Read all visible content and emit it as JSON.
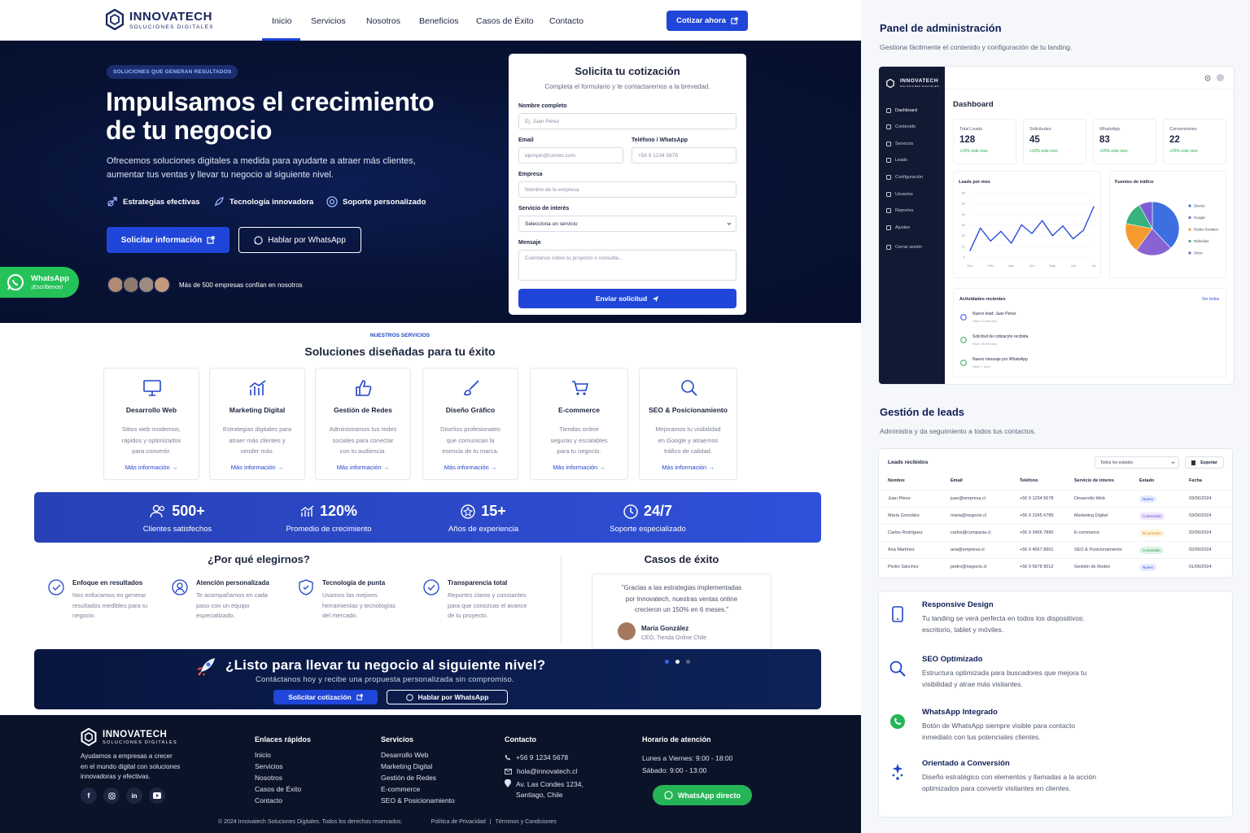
{
  "brand": {
    "name": "INNOVATECH",
    "tagline": "SOLUCIONES DIGITALES"
  },
  "nav": {
    "items": [
      "Inicio",
      "Servicios",
      "Nosotros",
      "Beneficios",
      "Casos de Éxito",
      "Contacto"
    ],
    "cta": "Cotizar ahora"
  },
  "hero": {
    "pill": "SOLUCIONES QUE GENERAN RESULTADOS",
    "title_1": "Impulsamos el crecimiento",
    "title_2": "de tu negocio",
    "subtitle_1": "Ofrecemos soluciones digitales a medida para ayudarte a atraer más clientes,",
    "subtitle_2": "aumentar tus ventas y llevar tu negocio al siguiente nivel.",
    "features": [
      "Estrategias efectivas",
      "Tecnología innovadora",
      "Soporte personalizado"
    ],
    "btn_primary": "Solicitar información",
    "btn_secondary": "Hablar por WhatsApp",
    "trust": "Más de 500 empresas confían en nosotros"
  },
  "whatsapp_float": {
    "title": "WhatsApp",
    "sub": "¡Escríbenos!"
  },
  "form": {
    "title": "Solicita tu cotización",
    "subtitle": "Completa el formulario y te contactaremos a la brevedad.",
    "name_label": "Nombre completo",
    "name_ph": "Ej. Juan Pérez",
    "email_label": "Email",
    "email_ph": "ejemplo@correo.com",
    "phone_label": "Teléfono / WhatsApp",
    "phone_ph": "+56 9 1234 5678",
    "company_label": "Empresa",
    "company_ph": "Nombre de tu empresa",
    "service_label": "Servicio de interés",
    "service_value": "Selecciona un servicio",
    "msg_label": "Mensaje",
    "msg_ph": "Cuéntanos sobre tu proyecto o consulta...",
    "submit": "Enviar solicitud"
  },
  "services": {
    "eyebrow": "NUESTROS SERVICIOS",
    "title": "Soluciones diseñadas para tu éxito",
    "more": "Más información",
    "items": [
      {
        "title": "Desarrollo Web",
        "l1": "Sitios web modernos,",
        "l2": "rápidos y optimizados",
        "l3": "para convertir."
      },
      {
        "title": "Marketing Digital",
        "l1": "Estrategias digitales para",
        "l2": "atraer más clientes y",
        "l3": "vender más."
      },
      {
        "title": "Gestión de Redes",
        "l1": "Administramos tus redes",
        "l2": "sociales para conectar",
        "l3": "con tu audiencia."
      },
      {
        "title": "Diseño Gráfico",
        "l1": "Diseños profesionales",
        "l2": "que comunican la",
        "l3": "esencia de tu marca."
      },
      {
        "title": "E-commerce",
        "l1": "Tiendas online",
        "l2": "seguras y escalables",
        "l3": "para tu negocio."
      },
      {
        "title": "SEO & Posicionamiento",
        "l1": "Mejoramos tu visibilidad",
        "l2": "en Google y atraemos",
        "l3": "tráfico de calidad."
      }
    ]
  },
  "stats": [
    {
      "n": "500+",
      "l": "Clientes satisfechos"
    },
    {
      "n": "120%",
      "l": "Promedio de crecimiento"
    },
    {
      "n": "15+",
      "l": "Años de experiencia"
    },
    {
      "n": "24/7",
      "l": "Soporte especializado"
    }
  ],
  "why": {
    "title": "¿Por qué elegirnos?",
    "items": [
      {
        "t": "Enfoque en resultados",
        "l1": "Nos enfocamos en generar",
        "l2": "resultados medibles para tu",
        "l3": "negocio."
      },
      {
        "t": "Atención personalizada",
        "l1": "Te acompañamos en cada",
        "l2": "paso con un equipo",
        "l3": "especializado."
      },
      {
        "t": "Tecnología de punta",
        "l1": "Usamos las mejores",
        "l2": "herramientas y tecnologías",
        "l3": "del mercado."
      },
      {
        "t": "Transparencia total",
        "l1": "Reportes claros y constantes",
        "l2": "para que conozcas el avance",
        "l3": "de tu proyecto."
      }
    ]
  },
  "cases": {
    "title": "Casos de éxito",
    "q1": "\"Gracias a las estrategias implementadas",
    "q2": "por Innovatech, nuestras ventas online",
    "q3": "crecieron un 150% en 6 meses.\"",
    "name": "María González",
    "role": "CEO, Tienda Online Chile"
  },
  "cta": {
    "title": "¿Listo para llevar tu negocio al siguiente nivel?",
    "sub": "Contáctanos hoy y recibe una propuesta personalizada sin compromiso.",
    "btn1": "Solicitar cotización",
    "btn2": "Hablar por WhatsApp"
  },
  "footer": {
    "about_1": "Ayudamos a empresas a crecer",
    "about_2": "en el mundo digital con soluciones",
    "about_3": "innovadoras y efectivas.",
    "links_title": "Enlaces rápidos",
    "links": [
      "Inicio",
      "Servicios",
      "Nosotros",
      "Casos de Éxito",
      "Contacto"
    ],
    "services_title": "Servicios",
    "services": [
      "Desarrollo Web",
      "Marketing Digital",
      "Gestión de Redes",
      "E-commerce",
      "SEO & Posicionamiento"
    ],
    "contact_title": "Contacto",
    "phone": "+56 9 1234 5678",
    "email": "hola@innovatech.cl",
    "address_1": "Av. Las Condes 1234,",
    "address_2": "Santiago, Chile",
    "hours_title": "Horario de atención",
    "hours_1": "Lunes a Viernes: 9:00 - 18:00",
    "hours_2": "Sábado: 9:00 - 13:00",
    "wa_btn": "WhatsApp directo",
    "copyright": "© 2024 Innovatech Soluciones Digitales. Todos los derechos reservados.",
    "privacy": "Política de Privacidad",
    "sep": "|",
    "terms": "Términos y Condiciones"
  },
  "admin": {
    "title": "Panel de administración",
    "subtitle": "Gestiona fácilmente el contenido y configuración de tu landing.",
    "sidebar": [
      "Dashboard",
      "Contenido",
      "Servicios",
      "Leads",
      "Configuración",
      "Usuarios",
      "Reportes",
      "Ajustes",
      "Cerrar sesión"
    ],
    "dash_title": "Dashboard",
    "kpis": [
      {
        "t": "Total Leads",
        "v": "128",
        "d": "+15% este mes"
      },
      {
        "t": "Solicitudes",
        "v": "45",
        "d": "+10% este mes"
      },
      {
        "t": "WhatsApp",
        "v": "83",
        "d": "+20% este mes"
      },
      {
        "t": "Conversiones",
        "v": "22",
        "d": "+25% este mes"
      }
    ],
    "activity_title": "Actividades recientes",
    "activity_link": "Ver todos",
    "activity": [
      {
        "t": "Nuevo lead: Juan Pérez",
        "s": "Hace 10 minutos"
      },
      {
        "t": "Solicitud de cotización recibida",
        "s": "Hace 25 minutos"
      },
      {
        "t": "Nuevo mensaje por WhatsApp",
        "s": "Hace 1 hora"
      }
    ]
  },
  "chart_data": [
    {
      "type": "line",
      "title": "Leads por mes",
      "categories": [
        "Ene",
        "Feb",
        "Mar",
        "Abr",
        "May",
        "Jun",
        "Jul"
      ],
      "yticks": [
        "0",
        "10",
        "20",
        "30",
        "40",
        "50",
        "60"
      ],
      "ylim": [
        0,
        60
      ],
      "x": [
        0,
        0.5,
        1,
        1.5,
        2,
        2.5,
        3,
        3.5,
        4,
        4.5,
        5,
        5.5,
        6
      ],
      "values": [
        6,
        27,
        15,
        24,
        13,
        30,
        22,
        34,
        20,
        29,
        17,
        25,
        47
      ],
      "color": "#2b4fd9"
    },
    {
      "type": "pie",
      "title": "Fuentes de tráfico",
      "labels": [
        "Directo",
        "Google",
        "Redes Sociales",
        "Referidos",
        "Otros"
      ],
      "values": [
        38,
        22,
        18,
        14,
        8
      ],
      "colors": [
        "#3d6fe0",
        "#8a63d2",
        "#f59a2e",
        "#36b37e",
        "#7c5cd6"
      ]
    }
  ],
  "leads": {
    "title": "Gestión de leads",
    "subtitle": "Administra y da seguimiento a todos tus contactos.",
    "table_title": "Leads recibidos",
    "filter": "Todos los estados",
    "export": "Exportar",
    "headers": [
      "Nombre",
      "Email",
      "Teléfono",
      "Servicio de interés",
      "Estado",
      "Fecha"
    ],
    "rows": [
      [
        "Juan Pérez",
        "juan@empresa.cl",
        "+56 9 1234 5678",
        "Desarrollo Web",
        "Nuevo",
        "03/06/2024"
      ],
      [
        "María González",
        "maria@negocio.cl",
        "+56 9 2345 6789",
        "Marketing Digital",
        "Contactado",
        "03/06/2024"
      ],
      [
        "Carlos Rodríguez",
        "carlos@compania.cl",
        "+56 9 3456 7890",
        "E-commerce",
        "En proceso",
        "02/06/2024"
      ],
      [
        "Ana Martínez",
        "ana@empresa.cl",
        "+56 9 4567 8901",
        "SEO & Posicionamiento",
        "Convertido",
        "02/06/2024"
      ],
      [
        "Pedro Sánchez",
        "pedro@negocio.cl",
        "+56 9 5678 9012",
        "Gestión de Redes",
        "Nuevo",
        "01/06/2024"
      ]
    ]
  },
  "benefits": [
    {
      "t": "Responsive Design",
      "l1": "Tu landing se verá perfecta en todos los dispositivos:",
      "l2": "escritorio, tablet y móviles."
    },
    {
      "t": "SEO Optimizado",
      "l1": "Estructura optimizada para buscadores que mejora tu",
      "l2": "visibilidad y atrae más visitantes."
    },
    {
      "t": "WhatsApp Integrado",
      "l1": "Botón de WhatsApp siempre visible para contacto",
      "l2": "inmediato con tus potenciales clientes."
    },
    {
      "t": "Orientado a Conversión",
      "l1": "Diseño estratégico con elementos y llamadas a la acción",
      "l2": "optimizados para convertir visitantes en clientes."
    }
  ]
}
